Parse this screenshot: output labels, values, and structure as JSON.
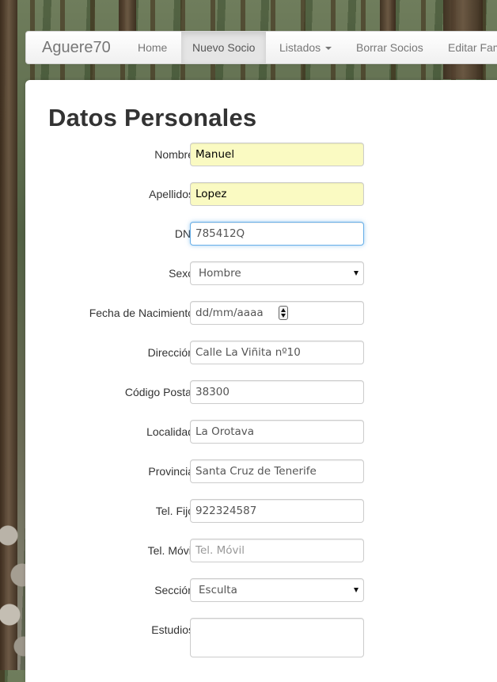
{
  "navbar": {
    "brand": "Aguere70",
    "items": [
      {
        "label": "Home",
        "active": false
      },
      {
        "label": "Nuevo Socio",
        "active": true
      },
      {
        "label": "Listados",
        "active": false,
        "dropdown": true
      },
      {
        "label": "Borrar Socios",
        "active": false
      },
      {
        "label": "Editar Fam",
        "active": false
      }
    ]
  },
  "form": {
    "title": "Datos Personales",
    "fields": {
      "nombre": {
        "label": "Nombre",
        "value": "Manuel"
      },
      "apellidos": {
        "label": "Apellidos",
        "value": "Lopez"
      },
      "dni": {
        "label": "DNI",
        "value": "785412Q"
      },
      "sexo": {
        "label": "Sexo",
        "selected": "Hombre"
      },
      "fecha": {
        "label": "Fecha de Nacimiento",
        "value": "dd/mm/aaaa"
      },
      "direccion": {
        "label": "Dirección",
        "value": "Calle La Viñita nº10"
      },
      "cp": {
        "label": "Código Postal",
        "value": "38300"
      },
      "localidad": {
        "label": "Localidad",
        "value": "La Orotava"
      },
      "provincia": {
        "label": "Provincia",
        "value": "Santa Cruz de Tenerife"
      },
      "tel_fijo": {
        "label": "Tel. Fijo",
        "value": "922324587"
      },
      "tel_movil": {
        "label": "Tel. Móvil",
        "value": "",
        "placeholder": "Tel. Móvil"
      },
      "seccion": {
        "label": "Sección",
        "selected": "Esculta"
      },
      "estudios": {
        "label": "Estudios",
        "value": ""
      }
    }
  },
  "icons": {
    "dropdown": "caret-down-icon",
    "select_arrow": "triangle-down-icon",
    "spinner": "spin-button-icon",
    "resize": "resize-grip-icon"
  }
}
